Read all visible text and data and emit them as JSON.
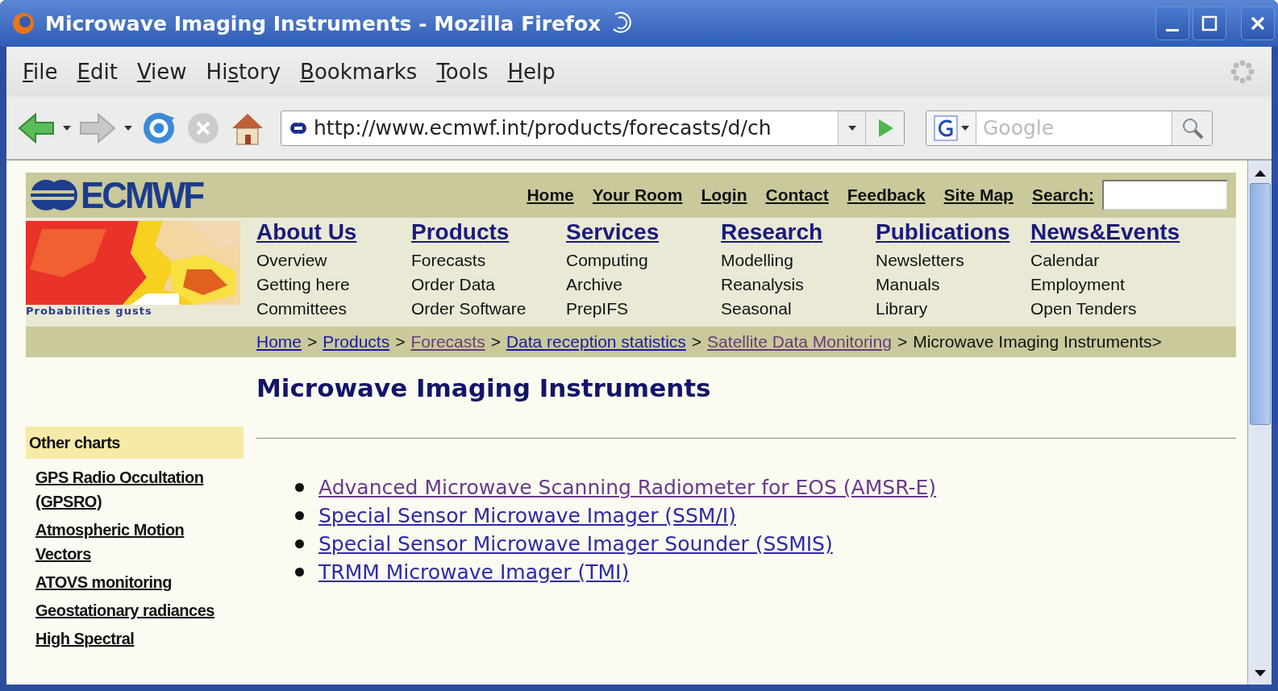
{
  "window": {
    "title": "Microwave Imaging Instruments - Mozilla Firefox"
  },
  "menu": [
    {
      "access_key": "F",
      "after": "ile"
    },
    {
      "access_key": "E",
      "after": "dit"
    },
    {
      "access_key": "V",
      "after": "iew"
    },
    {
      "before": "Hi",
      "access_key": "s",
      "after": "tory"
    },
    {
      "access_key": "B",
      "after": "ookmarks"
    },
    {
      "access_key": "T",
      "after": "ools"
    },
    {
      "access_key": "H",
      "after": "elp"
    }
  ],
  "toolbar": {
    "back_disabled": false,
    "forward_disabled": true,
    "stop_disabled": true,
    "url": "http://www.ecmwf.int/products/forecasts/d/ch",
    "search": {
      "placeholder": "Google"
    }
  },
  "site": {
    "logo": "ECMWF",
    "top_links": [
      "Home",
      "Your Room",
      "Login",
      "Contact",
      "Feedback",
      "Site Map"
    ],
    "search_label": "Search:",
    "map_caption": "Probabilities gusts",
    "nav": [
      {
        "title": "About Us",
        "items": [
          "Overview",
          "Getting here",
          "Committees"
        ]
      },
      {
        "title": "Products",
        "items": [
          "Forecasts",
          "Order Data",
          "Order Software"
        ]
      },
      {
        "title": "Services",
        "items": [
          "Computing",
          "Archive",
          "PrepIFS"
        ]
      },
      {
        "title": "Research",
        "items": [
          "Modelling",
          "Reanalysis",
          "Seasonal"
        ]
      },
      {
        "title": "Publications",
        "items": [
          "Newsletters",
          "Manuals",
          "Library"
        ]
      },
      {
        "title": "News&Events",
        "items": [
          "Calendar",
          "Employment",
          "Open Tenders"
        ]
      }
    ],
    "breadcrumb": [
      {
        "label": "Home",
        "visited": false
      },
      {
        "label": "Products",
        "visited": false
      },
      {
        "label": "Forecasts",
        "visited": true
      },
      {
        "label": "Data reception statistics",
        "visited": false
      },
      {
        "label": "Satellite Data Monitoring",
        "visited": true
      }
    ],
    "breadcrumb_separator": ">",
    "breadcrumb_current": "Microwave Imaging Instruments>",
    "heading": "Microwave Imaging Instruments",
    "sidebar": {
      "title": "Other charts",
      "links": [
        "GPS Radio Occultation (GPSRO)",
        "Atmospheric Motion Vectors",
        "ATOVS monitoring",
        "Geostationary radiances",
        "High Spectral"
      ]
    },
    "links": [
      {
        "label": "Advanced Microwave Scanning Radiometer for EOS (AMSR-E)",
        "visited": true
      },
      {
        "label": "Special Sensor Microwave Imager (SSM/I)",
        "visited": false
      },
      {
        "label": "Special Sensor Microwave Imager Sounder (SSMIS)",
        "visited": false
      },
      {
        "label": "TRMM Microwave Imager (TMI)",
        "visited": false
      }
    ]
  }
}
